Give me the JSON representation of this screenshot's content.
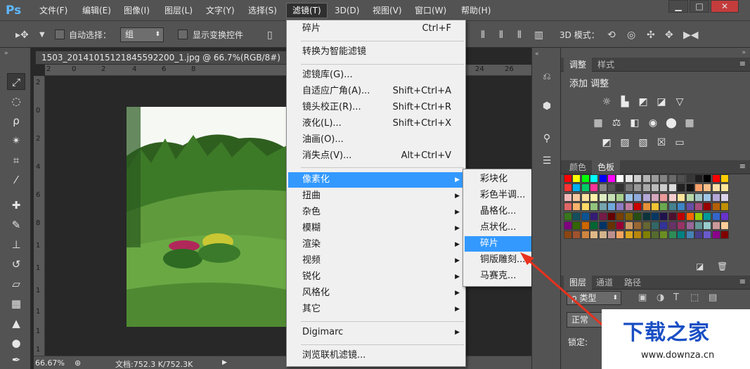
{
  "menubar": {
    "logo": "Ps",
    "items": [
      "文件(F)",
      "编辑(E)",
      "图像(I)",
      "图层(L)",
      "文字(Y)",
      "选择(S)",
      "滤镜(T)",
      "3D(D)",
      "视图(V)",
      "窗口(W)",
      "帮助(H)"
    ],
    "window_buttons": [
      "▁",
      "□",
      "✕"
    ]
  },
  "options": {
    "auto_select_label": "自动选择：",
    "group_value": "组",
    "show_transform_label": "显示变换控件",
    "mode_3d_label": "3D 模式："
  },
  "document": {
    "tab_title": "1503_20141015121845592200_1.jpg @ 66.7%(RGB/8#)",
    "ruler_h": [
      "2",
      "0",
      "2",
      "4",
      "6",
      "8",
      "24",
      "26"
    ],
    "ruler_v": [
      "2",
      "0",
      "2",
      "4",
      "6",
      "8",
      "1",
      "1",
      "1",
      "1",
      "1",
      "1"
    ],
    "status_zoom": "66.67%",
    "status_doc": "文档:752.3 K/752.3K"
  },
  "filter_menu": {
    "top": [
      {
        "label": "碎片",
        "shortcut": "Ctrl+F"
      },
      {
        "label": "转换为智能滤镜",
        "shortcut": ""
      }
    ],
    "group2": [
      {
        "label": "滤镜库(G)...",
        "shortcut": ""
      },
      {
        "label": "自适应广角(A)...",
        "shortcut": "Shift+Ctrl+A"
      },
      {
        "label": "镜头校正(R)...",
        "shortcut": "Shift+Ctrl+R"
      },
      {
        "label": "液化(L)...",
        "shortcut": "Shift+Ctrl+X"
      },
      {
        "label": "油画(O)...",
        "shortcut": ""
      },
      {
        "label": "消失点(V)...",
        "shortcut": "Alt+Ctrl+V"
      }
    ],
    "submenus": [
      "像素化",
      "扭曲",
      "杂色",
      "模糊",
      "渲染",
      "视频",
      "锐化",
      "风格化",
      "其它"
    ],
    "digimarc": "Digimarc",
    "browse": "浏览联机滤镜..."
  },
  "pixelate_submenu": {
    "items": [
      "彩块化",
      "彩色半调...",
      "晶格化...",
      "点状化...",
      "碎片",
      "铜版雕刻...",
      "马赛克..."
    ],
    "highlighted_index": 4
  },
  "panels": {
    "adjust_tabs": [
      "调整",
      "样式"
    ],
    "adjust_title": "添加 调整",
    "color_tabs": [
      "颜色",
      "色板"
    ],
    "layers_tabs": [
      "图层",
      "通道",
      "路径"
    ],
    "kind_label": "ρ 类型",
    "blend_mode": "正常",
    "lock_label": "锁定:"
  },
  "swatches": {
    "rows": [
      [
        "#ff0000",
        "#ffff00",
        "#00ff00",
        "#00ffff",
        "#0000ff",
        "#ff00ff",
        "#ffffff",
        "#e6e6e6",
        "#cdcdcd",
        "#b4b4b4",
        "#9b9b9b",
        "#828282",
        "#696969",
        "#505050",
        "#373737",
        "#1e1e1e",
        "#000000",
        "#ff0000",
        "#ffcc00"
      ],
      [
        "#ff3333",
        "#00b0f0",
        "#00cc66",
        "#ff3399",
        "#888888",
        "#555555",
        "#333333",
        "#777777",
        "#999999",
        "#aaaaaa",
        "#bbbbbb",
        "#cccccc",
        "#dddddd",
        "#222222",
        "#111111",
        "#f6a06a",
        "#f9c089",
        "#fde0a8",
        "#ffe699"
      ],
      [
        "#f2b8b8",
        "#f7c7a1",
        "#fbe0a0",
        "#fff2a8",
        "#dcedc1",
        "#c5e0b4",
        "#a9d18e",
        "#9dc3e6",
        "#8faadc",
        "#b4a7d6",
        "#d5a6bd",
        "#ea9999",
        "#f4cccc",
        "#ffe599",
        "#b6d7a8",
        "#a2c4c9",
        "#9fc5e8",
        "#b4a7d6",
        "#d9d2e9"
      ],
      [
        "#e06666",
        "#f6b26b",
        "#ffd966",
        "#93c47d",
        "#76a5af",
        "#6fa8dc",
        "#8e7cc3",
        "#c27ba0",
        "#cc0000",
        "#e69138",
        "#f1c232",
        "#6aa84f",
        "#45818e",
        "#3d85c6",
        "#674ea7",
        "#a64d79",
        "#990000",
        "#b45f06",
        "#bf9000"
      ],
      [
        "#38761d",
        "#134f5c",
        "#0b5394",
        "#351c75",
        "#741b47",
        "#660000",
        "#783f04",
        "#7f6000",
        "#274e13",
        "#0c343d",
        "#073763",
        "#20124d",
        "#4c1130",
        "#c00000",
        "#ff6600",
        "#99cc00",
        "#009999",
        "#3366cc",
        "#6633cc"
      ],
      [
        "#800080",
        "#336600",
        "#cc6600",
        "#006633",
        "#003366",
        "#663300",
        "#990033",
        "#cc9966",
        "#996633",
        "#666633",
        "#336666",
        "#333399",
        "#663366",
        "#993366",
        "#996699",
        "#669999",
        "#99cccc",
        "#cc9999",
        "#ffcc99"
      ],
      [
        "#8b4513",
        "#a0522d",
        "#cd853f",
        "#deb887",
        "#d2b48c",
        "#bc8f8f",
        "#f4a460",
        "#daa520",
        "#b8860b",
        "#808000",
        "#556b2f",
        "#6b8e23",
        "#2e8b57",
        "#008080",
        "#4682b4",
        "#483d8b",
        "#6a5acd",
        "#8b008b",
        "#800000"
      ]
    ]
  },
  "watermark": {
    "title": "下载之家",
    "url": "www.downza.cn"
  },
  "colors": {
    "menu_highlight": "#3399ff",
    "watermark_blue": "#1a4fc4",
    "arrow_red": "#e8321e"
  }
}
